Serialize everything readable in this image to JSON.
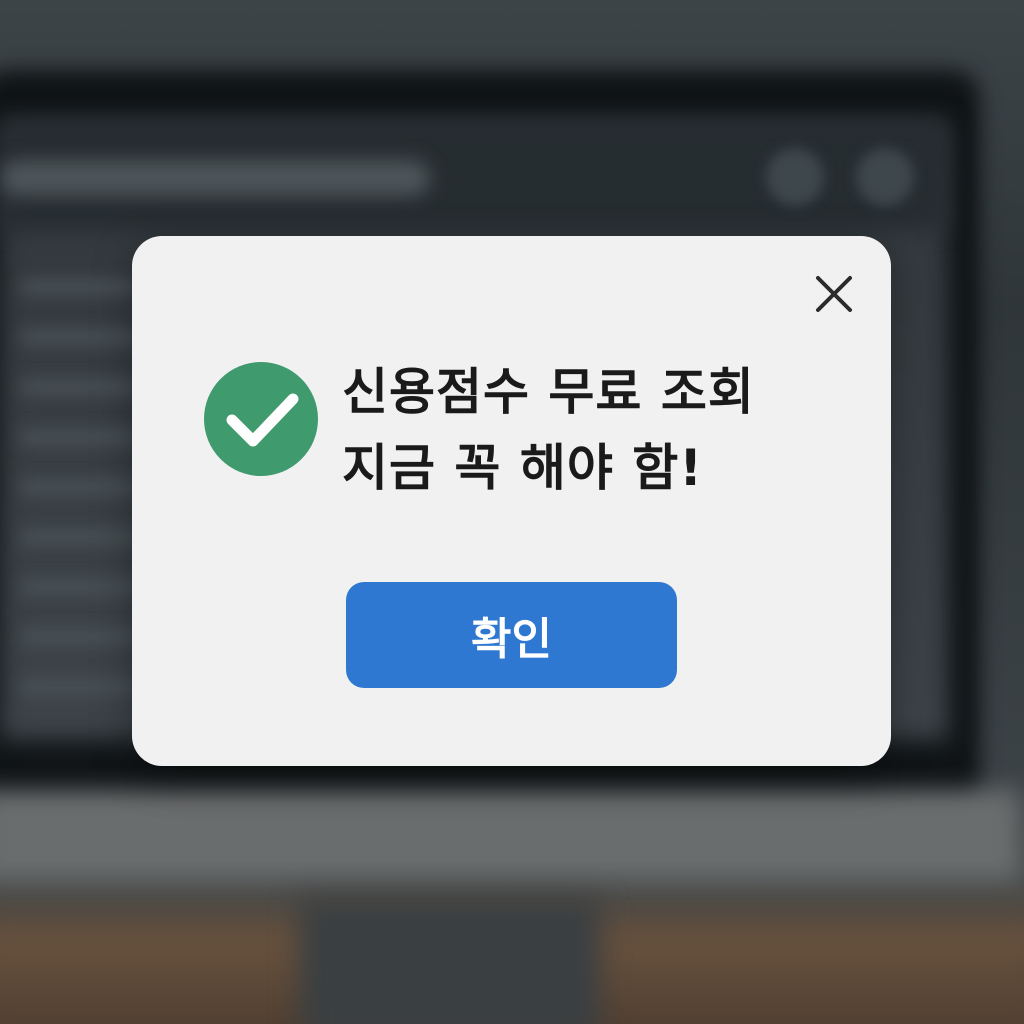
{
  "dialog": {
    "message_line1": "신용점수 무료 조회",
    "message_line2": "지금 꼭 해야 함!",
    "confirm_label": "확인",
    "close_icon": "close-icon",
    "status_icon": "check-circle-icon"
  },
  "colors": {
    "accent": "#2f78d2",
    "success": "#3f9a6e",
    "dialog_background": "#f1f1f1",
    "text": "#1a1a1a"
  }
}
